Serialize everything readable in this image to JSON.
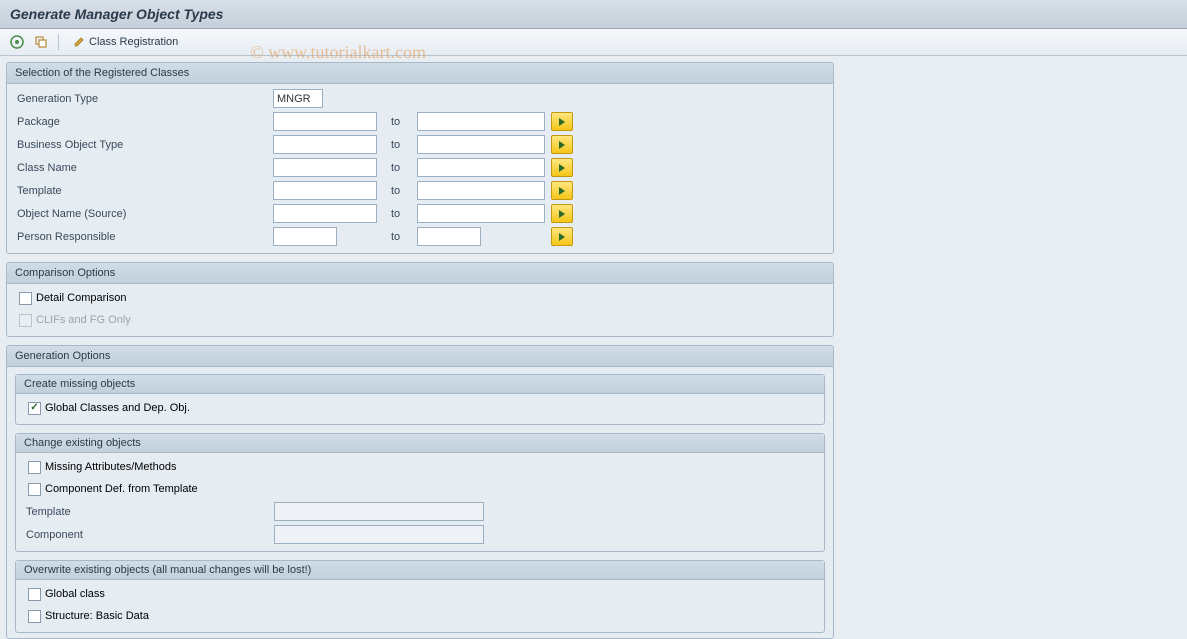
{
  "title": "Generate Manager Object Types",
  "watermark": "© www.tutorialkart.com",
  "toolbar": {
    "class_registration": "Class Registration"
  },
  "selection": {
    "header": "Selection of the Registered Classes",
    "rows": {
      "generation_type": {
        "label": "Generation Type",
        "value": "MNGR"
      },
      "package": {
        "label": "Package",
        "from": "",
        "to_label": "to",
        "to": ""
      },
      "business_object_type": {
        "label": "Business Object Type",
        "from": "",
        "to_label": "to",
        "to": ""
      },
      "class_name": {
        "label": "Class Name",
        "from": "",
        "to_label": "to",
        "to": ""
      },
      "template": {
        "label": "Template",
        "from": "",
        "to_label": "to",
        "to": ""
      },
      "object_name_source": {
        "label": "Object Name (Source)",
        "from": "",
        "to_label": "to",
        "to": ""
      },
      "person_responsible": {
        "label": "Person Responsible",
        "from": "",
        "to_label": "to",
        "to": ""
      }
    }
  },
  "comparison": {
    "header": "Comparison Options",
    "detail_comparison": {
      "label": "Detail Comparison",
      "checked": false
    },
    "clifs_fg_only": {
      "label": "CLIFs and FG Only",
      "checked": false,
      "disabled": true
    }
  },
  "generation": {
    "header": "Generation Options",
    "create_missing": {
      "header": "Create missing objects",
      "global_classes": {
        "label": "Global Classes and Dep. Obj.",
        "checked": true
      }
    },
    "change_existing": {
      "header": "Change existing objects",
      "missing_attr": {
        "label": "Missing Attributes/Methods",
        "checked": false
      },
      "component_def": {
        "label": "Component Def. from Template",
        "checked": false
      },
      "template": {
        "label": "Template",
        "value": ""
      },
      "component": {
        "label": "Component",
        "value": ""
      }
    },
    "overwrite": {
      "header": "Overwrite existing objects (all manual changes will be lost!)",
      "global_class": {
        "label": "Global class",
        "checked": false
      },
      "structure_basic": {
        "label": "Structure: Basic Data",
        "checked": false
      }
    }
  }
}
